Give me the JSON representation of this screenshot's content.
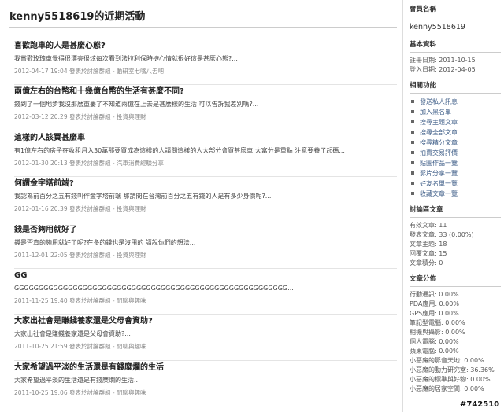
{
  "page_title": "kenny5518619的近期活動",
  "posts": [
    {
      "title": "喜歡跑車的人是甚麼心態?",
      "excerpt": "我嘗歡玫瑰車覺得很漂亮很炫每次看到法拉利保時捷心情就很好這是甚麼心態?...",
      "meta": "2012-04-17 19:04 發表於討論群組 - 動研室七嘴八舌吧"
    },
    {
      "title": "兩億左右的台幣和十幾億台幣的生活有甚麼不同?",
      "excerpt": "錢到了一個地步我沒那麼重要了不知道兩億在上去是甚麼樣的生活 可以告訴我差別嗎?...",
      "meta": "2012-03-12 20:29 發表於討論群組 - 投資與理財"
    },
    {
      "title": "這樣的人該買甚麼車",
      "excerpt": "有1億左右的房子在收租月入30萬那要買成為這樣的人請問這樣的人大部分會買甚麼車 大富分是重點 注意要養了起碼...",
      "meta": "2012-01-30 20:13 發表於討論群組 - 汽車消費經驗分享"
    },
    {
      "title": "何謂金字塔前端?",
      "excerpt": "我認為前百分之五有錢叫作金字塔前端 那請問在台灣前百分之五有錢的人是有多少身價呢?...",
      "meta": "2012-01-16 20:39 發表於討論群組 - 投資與理財"
    },
    {
      "title": "錢是否夠用就好了",
      "excerpt": "錢是否真的夠用就好了呢?在多的錢也是沒用的 請說你們的想法...",
      "meta": "2011-12-01 22:05 發表於討論群組 - 投資與理財"
    },
    {
      "title": "GG",
      "excerpt": "GGGGGGGGGGGGGGGGGGGGGGGGGGGGGGGGGGGGGGGGGGGGGGGGGGGGGGGG...",
      "meta": "2011-11-25 19:40 發表於討論群組 - 閒聊與趣味"
    },
    {
      "title": "大家出社會是賺錢養家還是父母會資助?",
      "excerpt": "大家出社會是賺錢養家還是父母會資助?...",
      "meta": "2011-10-25 21:59 發表於討論群組 - 閒聊與趣味"
    },
    {
      "title": "大家希望過平淡的生活還是有錢糜爛的生活",
      "excerpt": "大家希望過平淡的生活還是有錢糜爛的生活...",
      "meta": "2011-10-25 19:06 發表於討論群組 - 閒聊與趣味"
    }
  ],
  "sidebar": {
    "member_heading": "會員名稱",
    "member_name": "kenny5518619",
    "basic_heading": "基本資料",
    "register_date": "註冊日期: 2011-10-15",
    "login_date": "登入日期: 2012-04-05",
    "functions_heading": "相關功能",
    "functions": [
      "發送私人訊息",
      "加入黑名單",
      "搜尋主題文章",
      "搜尋全部文章",
      "搜尋精分文章",
      "拍賣交易評價",
      "貼圖作品一覽",
      "影片分享一覽",
      "好友名單一覽",
      "收藏文章一覽"
    ],
    "forum_heading": "討論區文章",
    "forum_stats": [
      "有效文章: 11",
      "發表文章: 33 (0.00%)",
      "文章主題: 18",
      "回覆文章: 15",
      "文章積分: 0"
    ],
    "dist_heading": "文章分佈",
    "dist": [
      "行動通訊: 0.00%",
      "PDA應用: 0.00%",
      "GPS應用: 0.00%",
      "筆記型電腦: 0.00%",
      "相機與攝影: 0.00%",
      "個人電腦: 0.00%",
      "蘋果電腦: 0.00%",
      "小惡魔的影音天地: 0.00%",
      "小惡魔的動力研究室: 36.36%",
      "小惡魔的標準與好物: 0.00%",
      "小惡魔的居家空間: 0.00%"
    ]
  },
  "watermark": "#742510"
}
